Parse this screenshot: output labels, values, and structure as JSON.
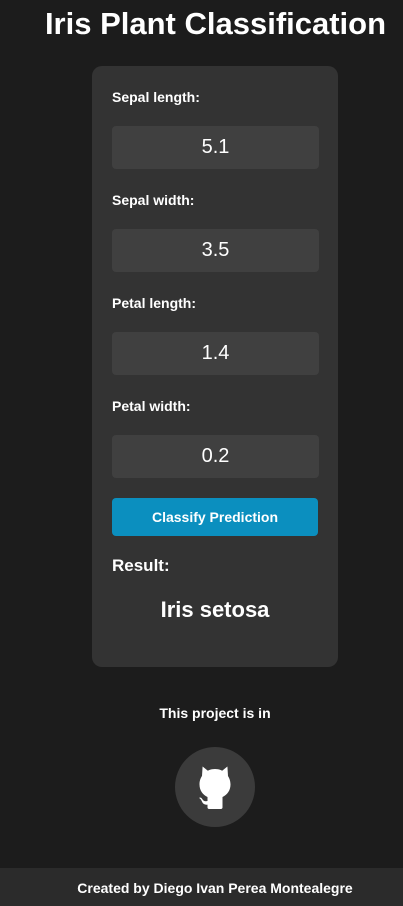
{
  "header": {
    "title": "Iris Plant Classification"
  },
  "form": {
    "fields": [
      {
        "label": "Sepal length:",
        "value": "5.1"
      },
      {
        "label": "Sepal width:",
        "value": "3.5"
      },
      {
        "label": "Petal length:",
        "value": "1.4"
      },
      {
        "label": "Petal width:",
        "value": "0.2"
      }
    ],
    "button_label": "Classify Prediction",
    "result_label": "Result:",
    "result_value": "Iris setosa"
  },
  "project": {
    "text": "This project is in",
    "icon": "github-icon"
  },
  "footer": {
    "text": "Created by Diego Ivan Perea Montealegre"
  },
  "colors": {
    "background": "#1c1c1c",
    "card": "#333333",
    "input": "#404040",
    "button": "#0b8fbf",
    "footer": "#2b2b2b"
  }
}
